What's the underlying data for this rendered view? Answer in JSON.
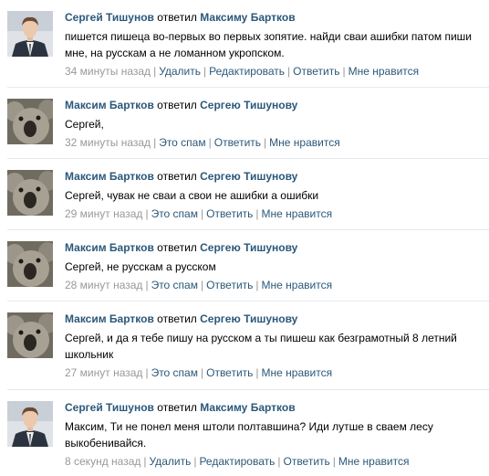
{
  "comments": [
    {
      "avatar": "person-avatar",
      "author": "Сергей Тишунов",
      "replied": "ответил",
      "target": "Максиму Бартков",
      "text": "пишется пишеца во-первых во первых зопятие. найди сваи ашибки патом пиши мне, на русскам а не ломанном укропском.",
      "time": "34 минуты назад",
      "actions": [
        "Удалить",
        "Редактировать",
        "Ответить",
        "Мне нравится"
      ]
    },
    {
      "avatar": "koala-avatar",
      "author": "Максим Бартков",
      "replied": "ответил",
      "target": "Сергею Тишунову",
      "text": "Сергей,",
      "time": "32 минуты назад",
      "actions": [
        "Это спам",
        "Ответить",
        "Мне нравится"
      ]
    },
    {
      "avatar": "koala-avatar",
      "author": "Максим Бартков",
      "replied": "ответил",
      "target": "Сергею Тишунову",
      "text": "Сергей, чувак не сваи а свои не ашибки а ошибки",
      "time": "29 минут назад",
      "actions": [
        "Это спам",
        "Ответить",
        "Мне нравится"
      ]
    },
    {
      "avatar": "koala-avatar",
      "author": "Максим Бартков",
      "replied": "ответил",
      "target": "Сергею Тишунову",
      "text": "Сергей, не русскам а русском",
      "time": "28 минут назад",
      "actions": [
        "Это спам",
        "Ответить",
        "Мне нравится"
      ]
    },
    {
      "avatar": "koala-avatar",
      "author": "Максим Бартков",
      "replied": "ответил",
      "target": "Сергею Тишунову",
      "text": "Сергей, и да я тебе пишу на русском а ты пишеш как безграмотный 8 летний школьник",
      "time": "27 минут назад",
      "actions": [
        "Это спам",
        "Ответить",
        "Мне нравится"
      ]
    },
    {
      "avatar": "person-avatar",
      "author": "Сергей Тишунов",
      "replied": "ответил",
      "target": "Максиму Бартков",
      "text": "Максим, Ти не понел меня штоли полтавшина? Иди лутше в сваем лесу выкобенивайся.",
      "time": "8 секунд назад",
      "actions": [
        "Удалить",
        "Редактировать",
        "Ответить",
        "Мне нравится"
      ]
    }
  ],
  "colors": {
    "link": "#2b587a",
    "meta": "#999999",
    "separator": "#e6e9ee"
  }
}
